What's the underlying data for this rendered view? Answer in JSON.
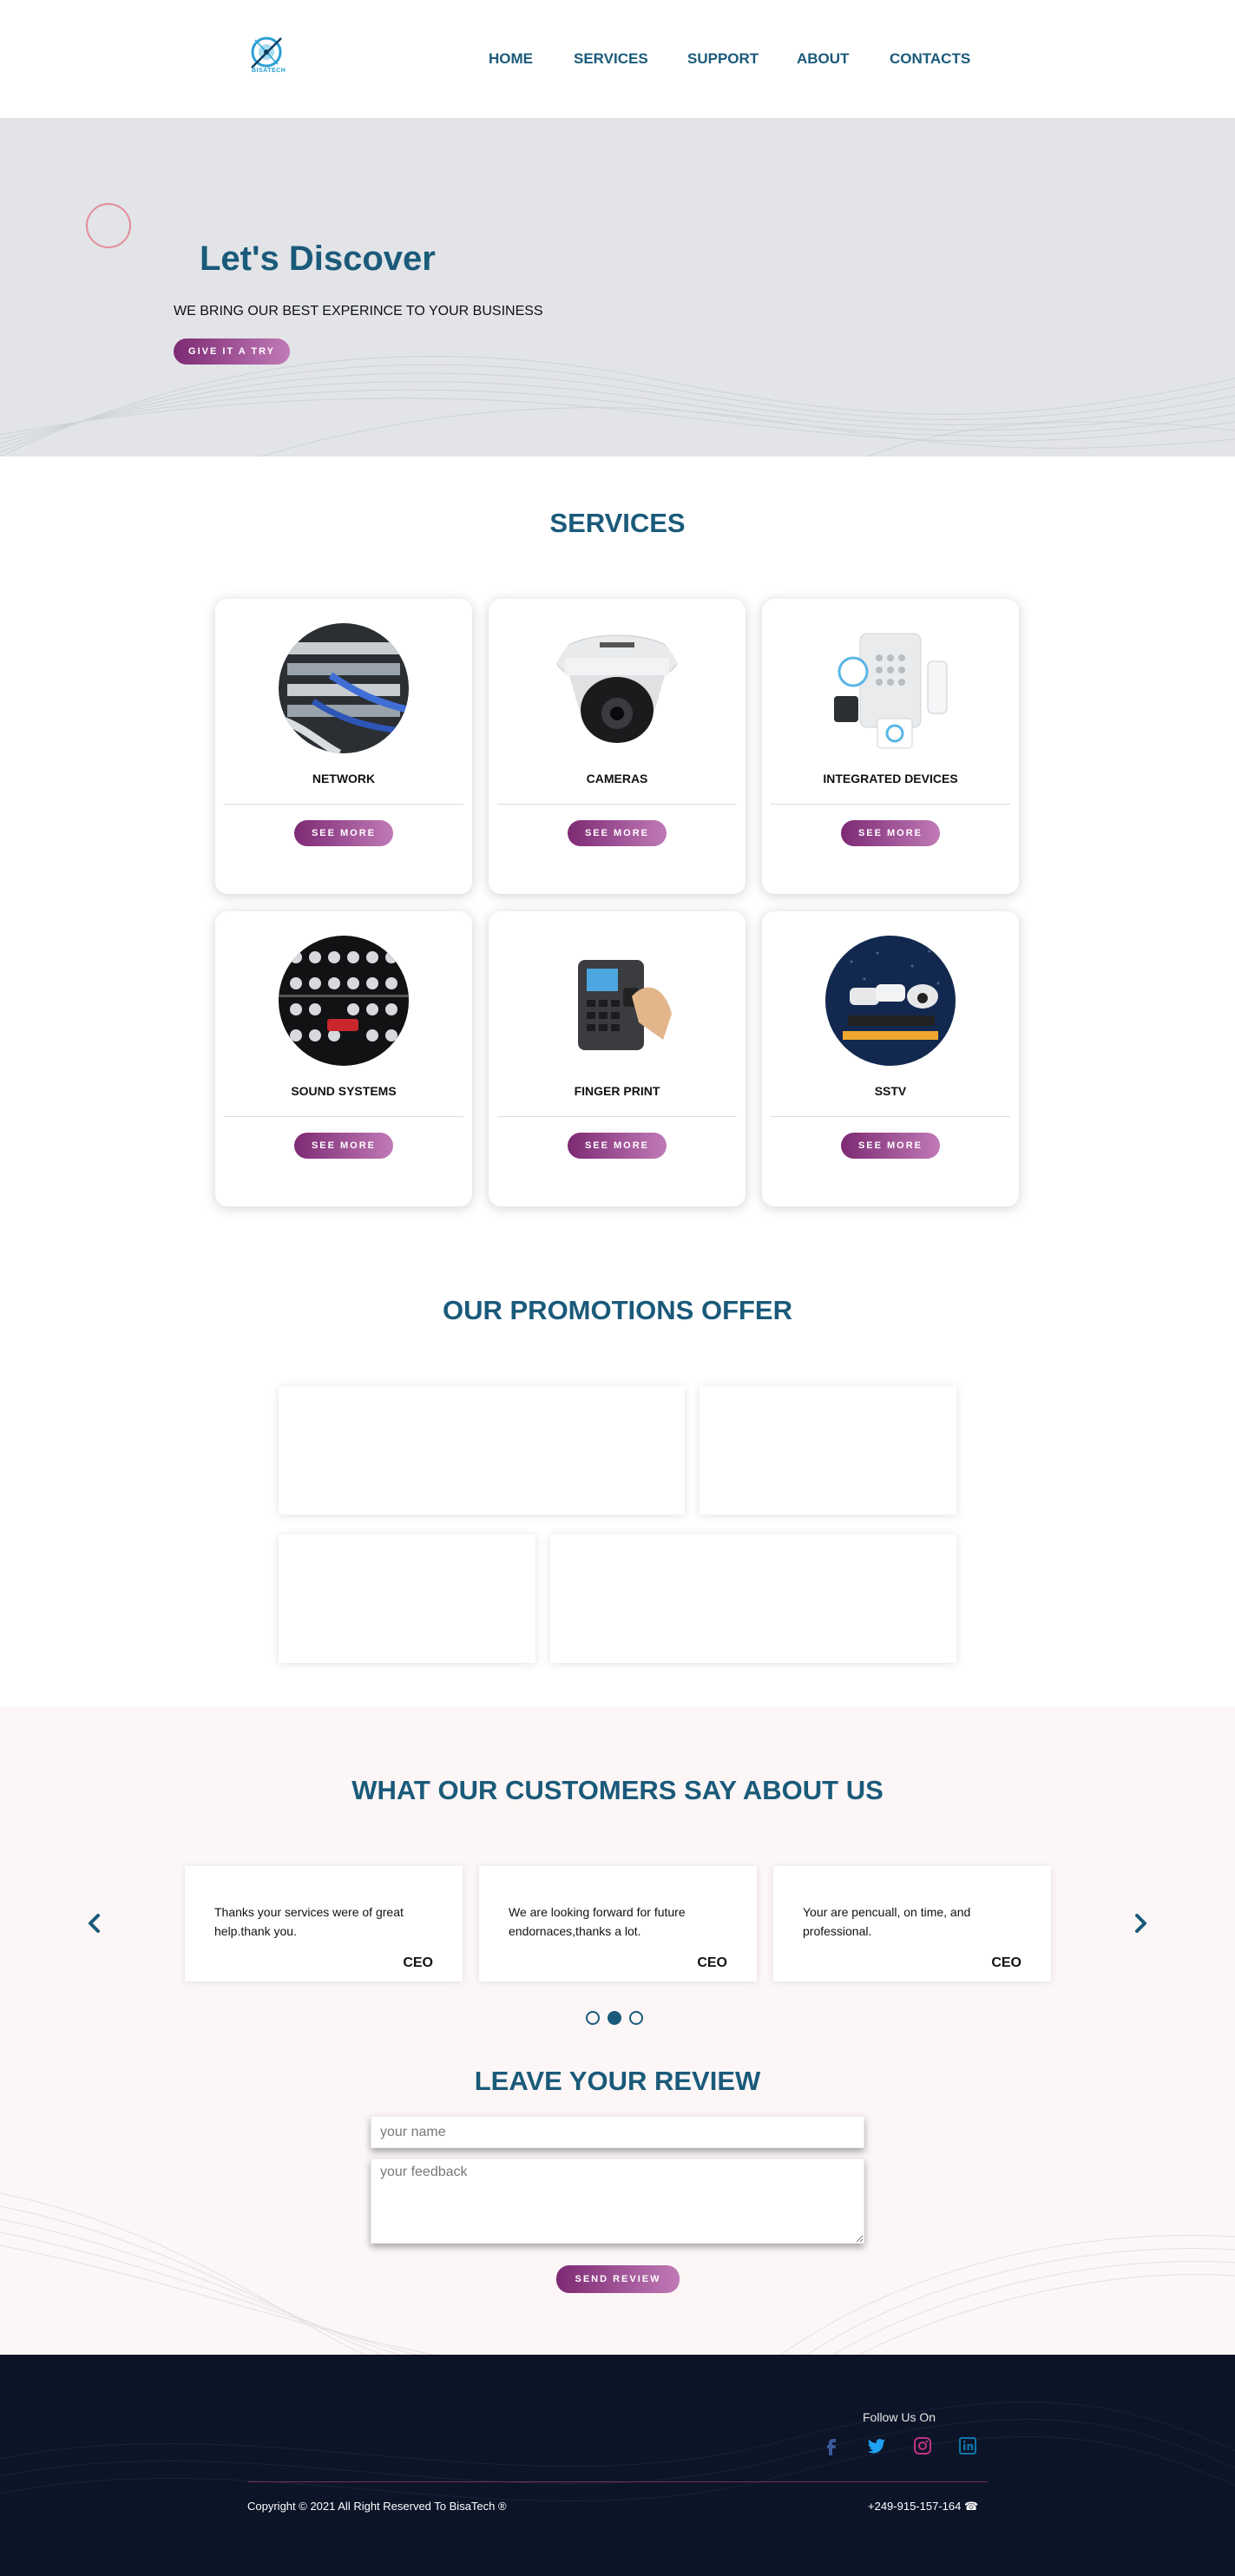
{
  "header": {
    "logo_text": "BISATECH",
    "nav": [
      {
        "label": "HOME"
      },
      {
        "label": "SERVICES"
      },
      {
        "label": "SUPPORT"
      },
      {
        "label": "ABOUT"
      },
      {
        "label": "CONTACTS"
      }
    ]
  },
  "hero": {
    "title": "Let's Discover",
    "subtitle": "WE BRING OUR BEST EXPERINCE TO YOUR BUSINESS",
    "button": "GIVE IT A TRY"
  },
  "services": {
    "title": "SERVICES",
    "items": [
      {
        "name": "NETWORK",
        "button": "SEE MORE"
      },
      {
        "name": "CAMERAS",
        "button": "SEE MORE"
      },
      {
        "name": "INTEGRATED DEVICES",
        "button": "SEE MORE"
      },
      {
        "name": "SOUND SYSTEMS",
        "button": "SEE MORE"
      },
      {
        "name": "FINGER PRINT",
        "button": "SEE MORE"
      },
      {
        "name": "SSTV",
        "button": "SEE MORE"
      }
    ]
  },
  "promotions": {
    "title": "OUR PROMOTIONS OFFER"
  },
  "testimonials": {
    "title": "WHAT OUR CUSTOMERS SAY ABOUT US",
    "items": [
      {
        "text": "Thanks your services were of great help.thank you.",
        "role": "CEO"
      },
      {
        "text": "We are looking forward for future endornaces,thanks a lot.",
        "role": "CEO"
      },
      {
        "text": "Your are pencuall, on time, and professional.",
        "role": "CEO"
      }
    ],
    "active_dot": 2
  },
  "review": {
    "title": "LEAVE YOUR REVIEW",
    "name_placeholder": "your name",
    "feedback_placeholder": "your feedback",
    "button": "SEND REVIEW"
  },
  "footer": {
    "follow": "Follow Us On",
    "copyright": "Copyright © 2021 All Right Reserved To BisaTech ®",
    "phone": "+249-915-157-164 ☎",
    "colors": {
      "facebook": "#3b5998",
      "twitter": "#1da1f2",
      "instagram": "#c13584",
      "linkedin": "#0e76a8"
    }
  },
  "theme": {
    "primary": "#1a5a7a",
    "accent_start": "#7d2a74",
    "accent_end": "#c07ab6"
  }
}
